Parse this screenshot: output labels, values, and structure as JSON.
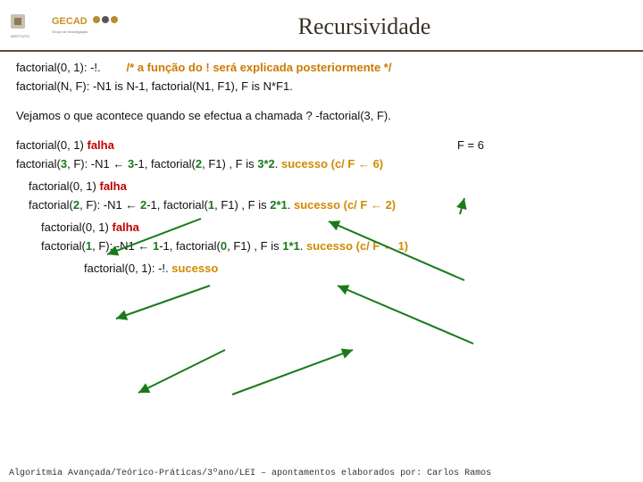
{
  "header": {
    "title": "Recursividade"
  },
  "code": {
    "base": "factorial(0, 1): -!.",
    "comment": "/* a função do ! será explicada posteriormente */",
    "rec": "factorial(N, F): -N1 is N-1, factorial(N1, F1), F is N*F1."
  },
  "narrative": "Vejamos o que acontece quando se efectua a chamada ? -factorial(3, F).",
  "step1": {
    "try_base": "factorial(0, 1)",
    "fail": " falha",
    "res_label": "F = 6",
    "rec_head": "factorial(",
    "n": "3",
    "mid1": ", F): -N1 ← ",
    "sub": "3",
    "mid2": "-1, factorial(",
    "c": "2",
    "mid3": ", F1)  ,  F is ",
    "exp": "3*2",
    "mid4": ". ",
    "succ": "sucesso (c/ F ← 6)"
  },
  "step2": {
    "try_base": "factorial(0, 1)",
    "fail": " falha",
    "rec_head": "factorial(",
    "n": "2",
    "mid1": ", F): -N1 ← ",
    "sub": "2",
    "mid2": "-1, factorial(",
    "c": "1",
    "mid3": ", F1)  , F is ",
    "exp": "2*1",
    "mid4": ". ",
    "succ": "sucesso (c/ F ← 2)"
  },
  "step3": {
    "try_base": "factorial(0, 1)",
    "fail": " falha",
    "rec_head": "factorial(",
    "n": "1",
    "mid1": ", F): -N1 ← ",
    "sub": "1",
    "mid2": "-1, factorial(",
    "c": "0",
    "mid3": ", F1)   ,  F is ",
    "exp": "1*1",
    "mid4": ". ",
    "succ": "sucesso (c/ F ← 1)"
  },
  "step4": {
    "base": "factorial(0, 1): -!.",
    "succ": " sucesso"
  },
  "footer": "Algoritmia Avançada/Teórico-Práticas/3ºano/LEI – apontamentos elaborados por: Carlos Ramos"
}
